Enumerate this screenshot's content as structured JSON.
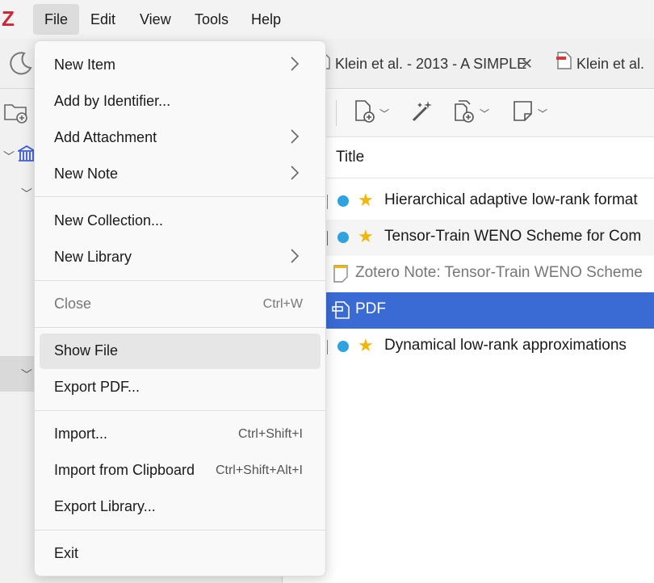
{
  "app": {
    "logo": "Z",
    "logo_color": "#cc2936"
  },
  "menubar": {
    "items": [
      {
        "label": "File",
        "active": true
      },
      {
        "label": "Edit"
      },
      {
        "label": "View"
      },
      {
        "label": "Tools"
      },
      {
        "label": "Help"
      }
    ]
  },
  "tabs": [
    {
      "label": "Klein et al. - 2013 - A SIMPLE",
      "icon": "document-icon"
    },
    {
      "label": "Klein et al.",
      "icon": "pdf-document-icon"
    }
  ],
  "items_list": {
    "column_title": "Title",
    "rows": [
      {
        "title": "Hierarchical adaptive low-rank format",
        "type": "journal",
        "dot_color": "#2ea3e0",
        "starred": true
      },
      {
        "title": "Tensor-Train WENO Scheme for Com",
        "type": "journal",
        "dot_color": "#2ea3e0",
        "starred": true
      },
      {
        "title": "Zotero Note: Tensor-Train WENO Scheme",
        "type": "note"
      },
      {
        "title": "PDF",
        "type": "pdf",
        "selected": true
      },
      {
        "title": "Dynamical low-rank approximations",
        "type": "journal",
        "dot_color": "#2ea3e0",
        "starred": true
      }
    ]
  },
  "file_menu": {
    "items": [
      {
        "label": "New Item",
        "submenu": true
      },
      {
        "label": "Add by Identifier..."
      },
      {
        "label": "Add Attachment",
        "submenu": true
      },
      {
        "label": "New Note",
        "submenu": true
      },
      {
        "label": "New Collection..."
      },
      {
        "label": "New Library",
        "submenu": true
      },
      {
        "label": "Close",
        "shortcut": "Ctrl+W",
        "disabled": true
      },
      {
        "label": "Show File",
        "hover": true
      },
      {
        "label": "Export PDF..."
      },
      {
        "label": "Import...",
        "shortcut": "Ctrl+Shift+I"
      },
      {
        "label": "Import from Clipboard",
        "shortcut": "Ctrl+Shift+Alt+I"
      },
      {
        "label": "Export Library..."
      },
      {
        "label": "Exit"
      }
    ]
  },
  "colors": {
    "selection": "#3a6bd4",
    "accent_blue_dot": "#2ea3e0",
    "star": "#f2b705"
  }
}
